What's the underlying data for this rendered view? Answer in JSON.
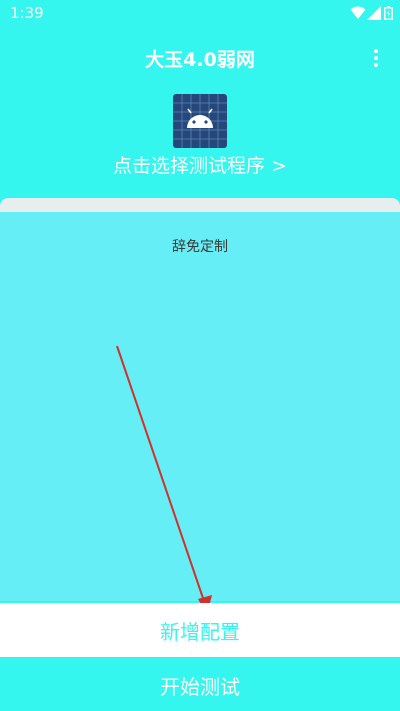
{
  "status_bar": {
    "time": "1:39",
    "icons": [
      "wifi-icon",
      "signal-icon",
      "battery-icon"
    ]
  },
  "header": {
    "title": "大玉4.0弱网",
    "menu_icon": "more-vertical-icon"
  },
  "program_selector": {
    "icon": "android-app-icon",
    "label": "点击选择测试程序 >"
  },
  "config_list": {
    "items": [
      {
        "name": "辞免定制"
      }
    ]
  },
  "actions": {
    "add_config_label": "新增配置",
    "start_test_label": "开始测试"
  },
  "colors": {
    "background": "#35f6ee",
    "panel": "#66eef7",
    "annotation_arrow": "#d0312d"
  }
}
